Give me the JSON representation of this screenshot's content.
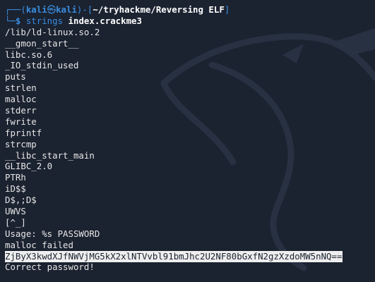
{
  "prompt": {
    "box_top": "┌──(",
    "user": "kali",
    "at": "㉿",
    "host": "kali",
    "close": ")-[",
    "path": "~/tryhackme/Reversing ELF",
    "path_close": "]",
    "box_bottom": "└─",
    "dollar": "$ ",
    "command": "strings",
    "argument": " index.crackme3"
  },
  "output_lines": [
    "/lib/ld-linux.so.2",
    "__gmon_start__",
    "libc.so.6",
    "_IO_stdin_used",
    "puts",
    "strlen",
    "malloc",
    "stderr",
    "fwrite",
    "fprintf",
    "strcmp",
    "__libc_start_main",
    "GLIBC_2.0",
    "PTRh",
    "iD$$",
    "D$,;D$",
    "UWVS",
    "[^_]",
    "Usage: %s PASSWORD",
    "malloc failed"
  ],
  "selected_line": "ZjByX3kwdXJfNWVjMG5kX2xlNTVvbl91bmJhc2U2NF80bGxfN2gzXzdoMW5nNQ==",
  "last_line": "Correct password!",
  "colors": {
    "background": "#1b2230",
    "prompt_accent": "#3a8dde",
    "text": "#e6e6e6",
    "selection": "#eeeeee"
  },
  "icons": {
    "background_logo": "kali-dragon-icon"
  }
}
